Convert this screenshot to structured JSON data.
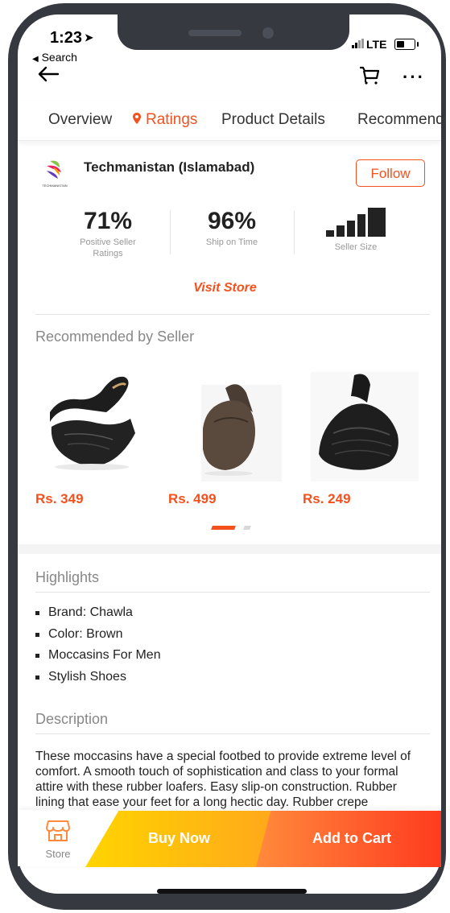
{
  "status_bar": {
    "time": "1:23",
    "back_label": "Search",
    "network": "LTE"
  },
  "tabs": [
    {
      "label": "Overview"
    },
    {
      "label": "Ratings",
      "active": true
    },
    {
      "label": "Product Details"
    },
    {
      "label": "Recommend"
    }
  ],
  "seller": {
    "logo_text": "TECHMANISTAN",
    "name": "Techmanistan (Islamabad)",
    "follow_label": "Follow",
    "positive_ratings": "71%",
    "positive_ratings_label": "Positive Seller Ratings",
    "ship_on_time": "96%",
    "ship_on_time_label": "Ship on Time",
    "seller_size_label": "Seller Size",
    "visit_store_label": "Visit Store"
  },
  "recommended": {
    "title": "Recommended by Seller",
    "products": [
      {
        "price": "Rs. 349",
        "color": "black-woven"
      },
      {
        "price": "Rs. 499",
        "color": "brown"
      },
      {
        "price": "Rs. 249",
        "color": "black-woven"
      }
    ]
  },
  "highlights": {
    "title": "Highlights",
    "items": [
      "Brand: Chawla",
      "Color: Brown",
      "Moccasins For Men",
      "Stylish Shoes"
    ]
  },
  "description": {
    "title": "Description",
    "text": "These moccasins have a special footbed to provide extreme level of comfort. A smooth touch of sophistication and class to your formal attire with these rubber loafers. Easy slip-on construction. Rubber lining that ease your feet for a long hectic day. Rubber crepe"
  },
  "bottom_bar": {
    "store_label": "Store",
    "buy_now_label": "Buy Now",
    "add_to_cart_label": "Add to Cart"
  },
  "colors": {
    "accent": "#f4511e",
    "buy_now_start": "#ffd400",
    "add_to_cart_end": "#ff3b1f",
    "frame": "#363a40"
  }
}
